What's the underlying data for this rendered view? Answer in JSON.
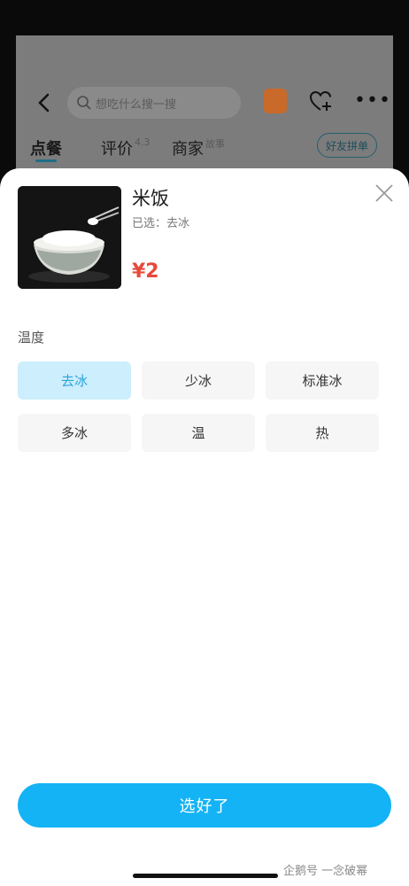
{
  "background": {
    "search_placeholder": "想吃什么搜一搜",
    "tabs": [
      {
        "label": "点餐",
        "sub": ""
      },
      {
        "label": "评价",
        "sub": "4.3"
      },
      {
        "label": "商家",
        "sub": "故事"
      }
    ],
    "group_order_label": "好友拼单",
    "icons": [
      "back-icon",
      "search-icon",
      "gift-icon",
      "favorite-icon",
      "more-icon"
    ]
  },
  "sheet": {
    "product": {
      "name": "米饭",
      "selected_text": "已选：去冰",
      "price": "¥2"
    },
    "option_group": {
      "label": "温度",
      "options": [
        {
          "label": "去冰",
          "selected": true
        },
        {
          "label": "少冰",
          "selected": false
        },
        {
          "label": "标准冰",
          "selected": false
        },
        {
          "label": "多冰",
          "selected": false
        },
        {
          "label": "温",
          "selected": false
        },
        {
          "label": "热",
          "selected": false
        }
      ]
    },
    "confirm_label": "选好了",
    "watermark": "企鹅号 一念破幂",
    "colors": {
      "accent": "#14b3f5",
      "selected_bg": "#cdeefc",
      "selected_text": "#2aa5d8",
      "price": "#e8493a"
    }
  }
}
